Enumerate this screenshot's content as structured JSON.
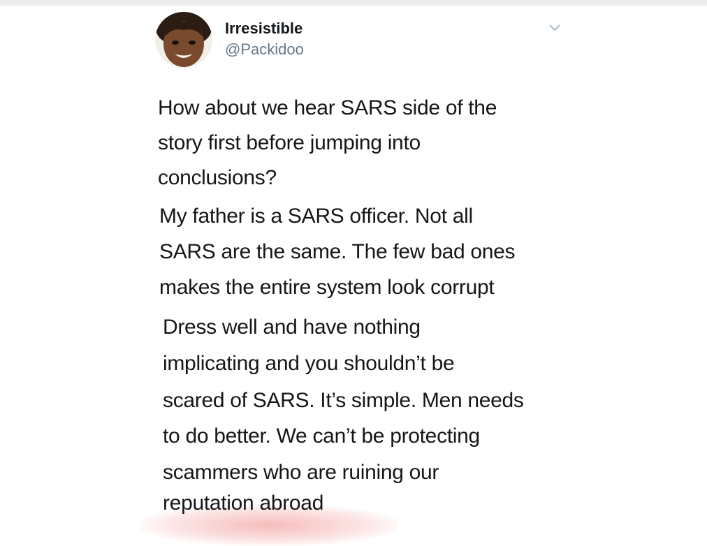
{
  "tweet": {
    "display_name": "Irresistible",
    "handle": "@Packidoo",
    "menu_icon": "chevron-down-icon",
    "body_lines": [
      "How about we hear SARS side of the",
      "story first before jumping into",
      "conclusions?",
      "My father is a SARS officer. Not all",
      "SARS are the same. The few bad ones",
      "makes the entire system look corrupt",
      "Dress well and have nothing",
      "implicating and you shouldn’t be",
      "scared of SARS. It’s simple. Men needs",
      "to do better. We can’t be protecting",
      "scammers who are ruining our",
      "reputation abroad"
    ]
  },
  "colors": {
    "text": "#14171a",
    "secondary_text": "#657786",
    "chevron": "#aab8c2",
    "top_strip": "#ececec"
  }
}
